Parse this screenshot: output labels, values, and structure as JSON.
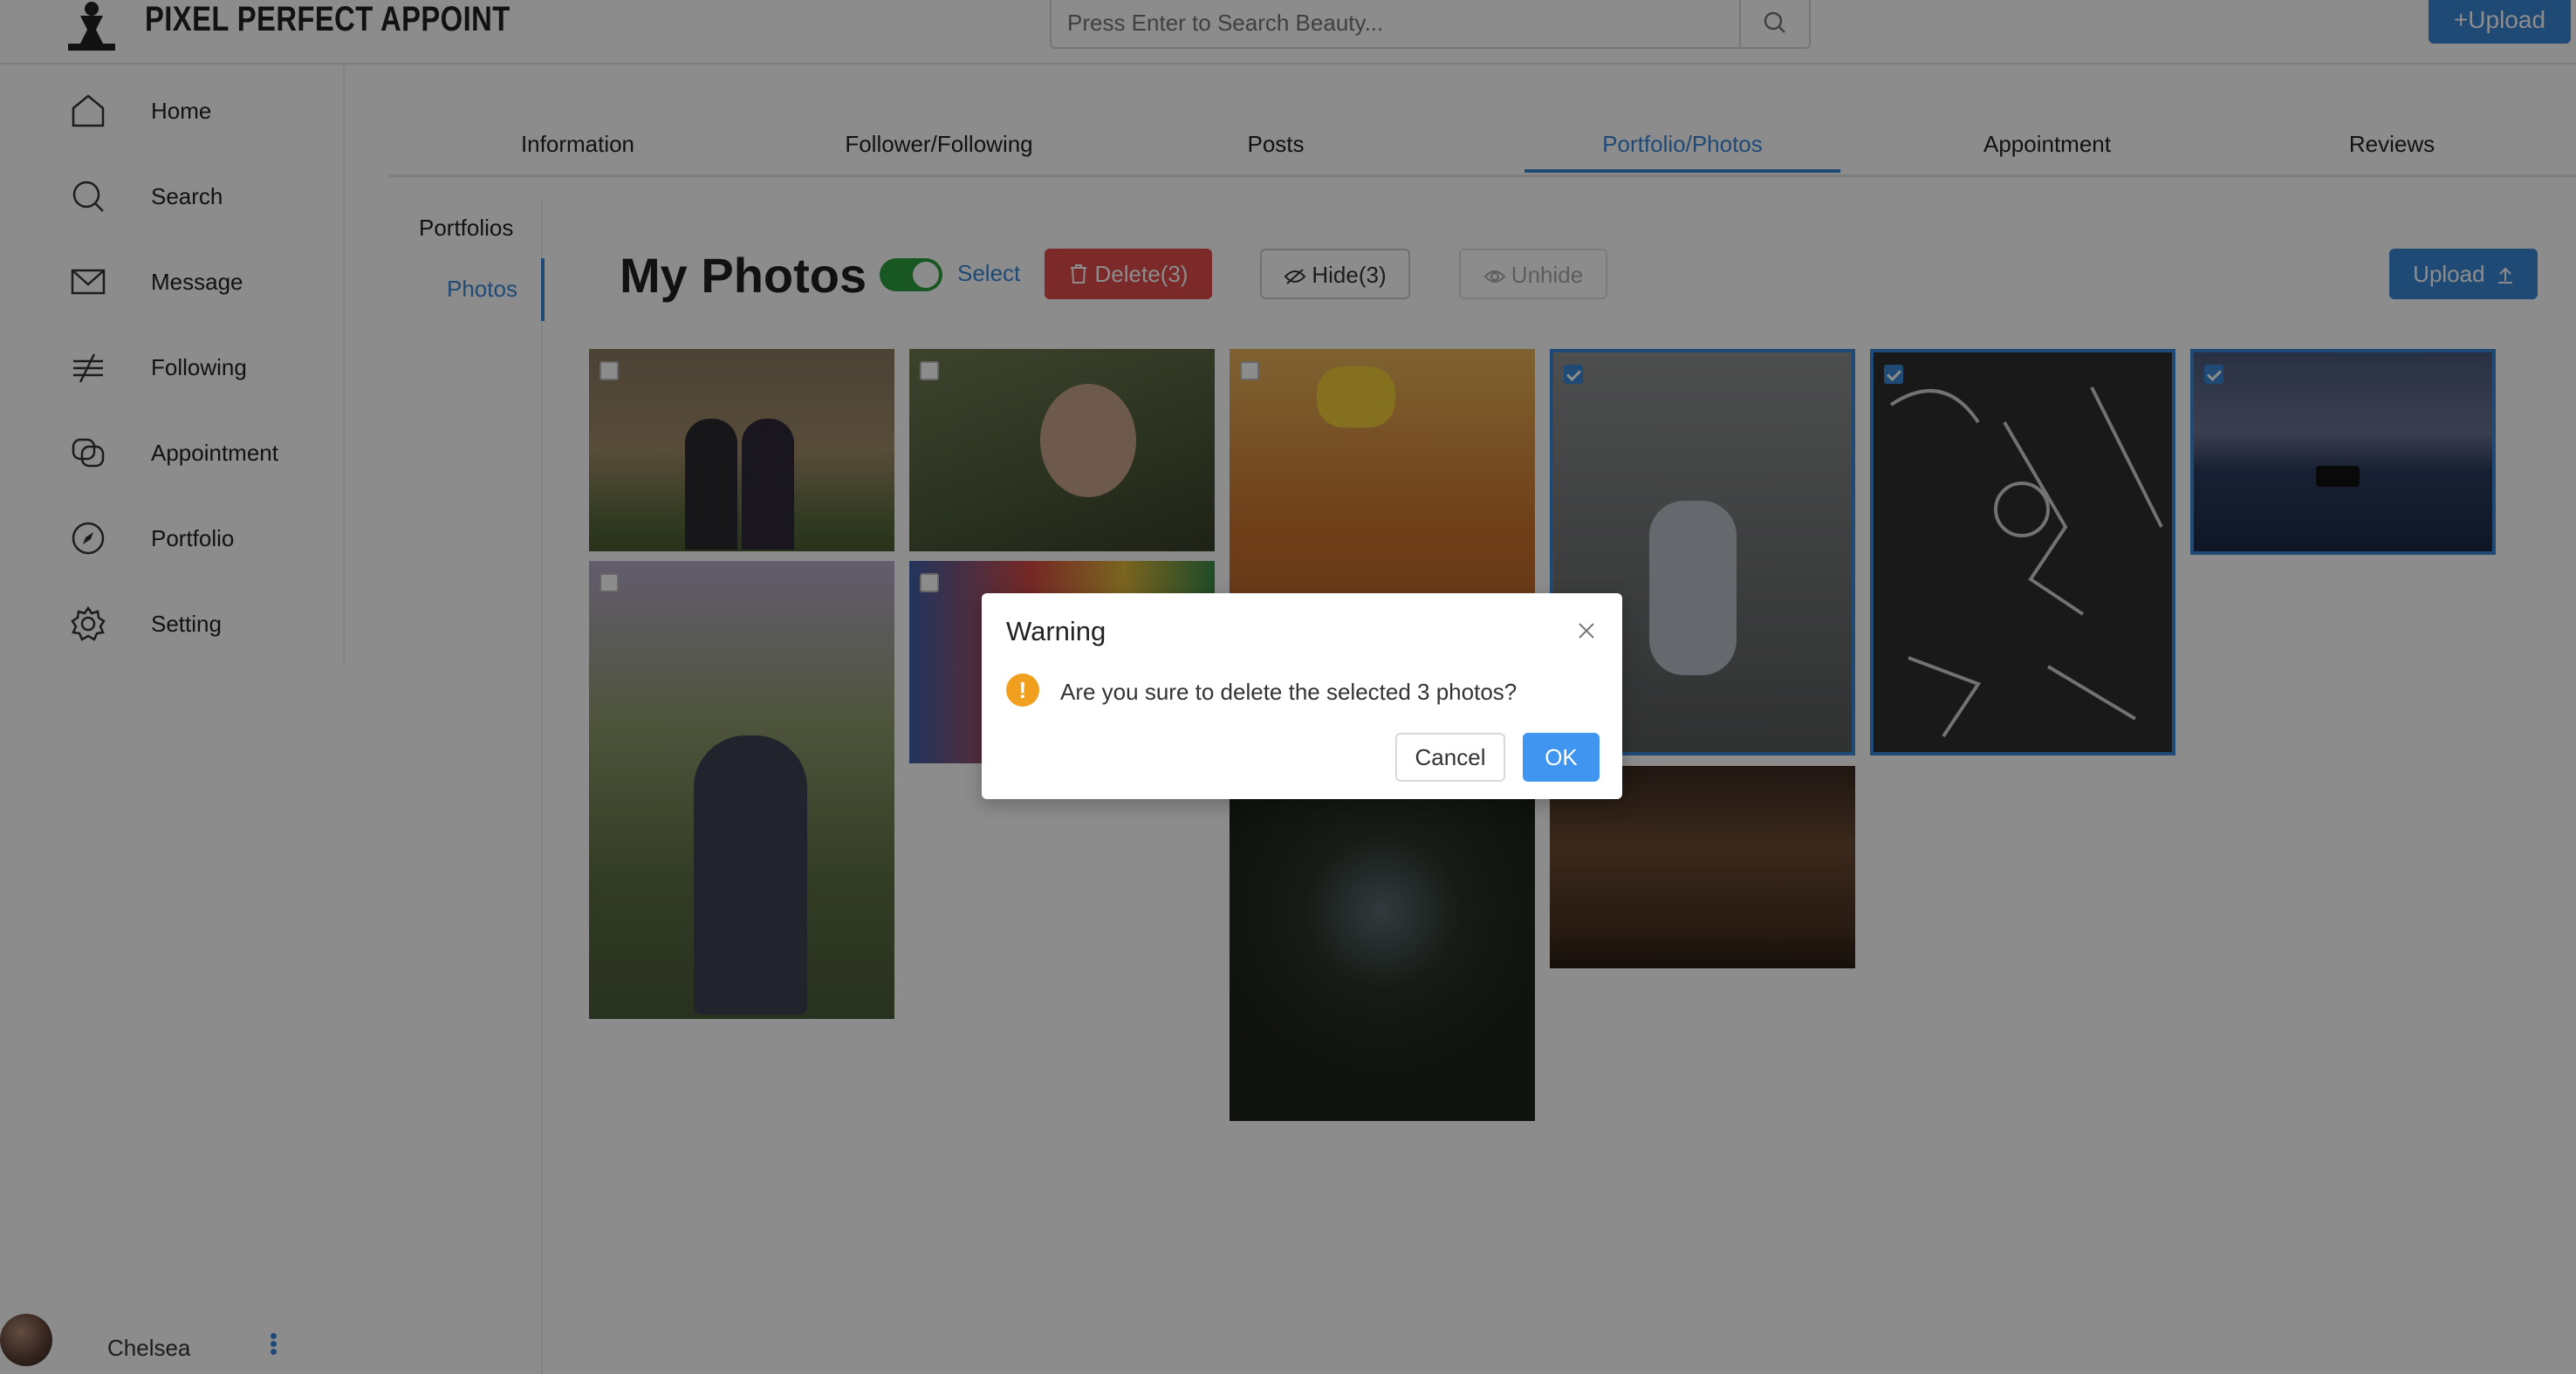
{
  "header": {
    "brand": "PIXEL PERFECT APPOINT",
    "search_placeholder": "Press Enter to Search Beauty...",
    "upload_label": "+Upload"
  },
  "sidebar": {
    "items": [
      {
        "label": "Home",
        "icon": "home-icon"
      },
      {
        "label": "Search",
        "icon": "search-icon"
      },
      {
        "label": "Message",
        "icon": "mail-icon"
      },
      {
        "label": "Following",
        "icon": "following-icon"
      },
      {
        "label": "Appointment",
        "icon": "appointment-icon"
      },
      {
        "label": "Portfolio",
        "icon": "compass-icon"
      },
      {
        "label": "Setting",
        "icon": "gear-icon"
      }
    ],
    "user": {
      "name": "Chelsea"
    }
  },
  "tabs": [
    {
      "label": "Information"
    },
    {
      "label": "Follower/Following"
    },
    {
      "label": "Posts"
    },
    {
      "label": "Portfolio/Photos",
      "active": true
    },
    {
      "label": "Appointment"
    },
    {
      "label": "Reviews"
    }
  ],
  "subnav": {
    "portfolios": "Portfolios",
    "photos": "Photos"
  },
  "toolbar": {
    "title": "My Photos",
    "select_label": "Select",
    "delete_label": "Delete(3)",
    "hide_label": "Hide(3)",
    "unhide_label": "Unhide",
    "upload_label": "Upload"
  },
  "photos": [
    {
      "subject": "two people in front of old building",
      "selected": false
    },
    {
      "subject": "person reaching toward camera",
      "selected": false
    },
    {
      "subject": "noodle dish with corn",
      "selected": false
    },
    {
      "subject": "doll on grey fabric",
      "selected": true
    },
    {
      "subject": "chalk drawing on blackboard",
      "selected": true
    },
    {
      "subject": "boat on water at dusk",
      "selected": true
    },
    {
      "subject": "person under wisteria",
      "selected": false
    },
    {
      "subject": "colorful mural",
      "selected": false
    },
    {
      "subject": "dark tunnel",
      "selected": false
    },
    {
      "subject": "dessert display",
      "selected": false
    }
  ],
  "dialog": {
    "title": "Warning",
    "message": "Are you sure to delete the selected 3 photos?",
    "cancel_label": "Cancel",
    "ok_label": "OK"
  },
  "colors": {
    "accent": "#3b87d8",
    "danger": "#e24b4b",
    "toggle_on": "#2f9e3f",
    "warning": "#f0a01e"
  }
}
